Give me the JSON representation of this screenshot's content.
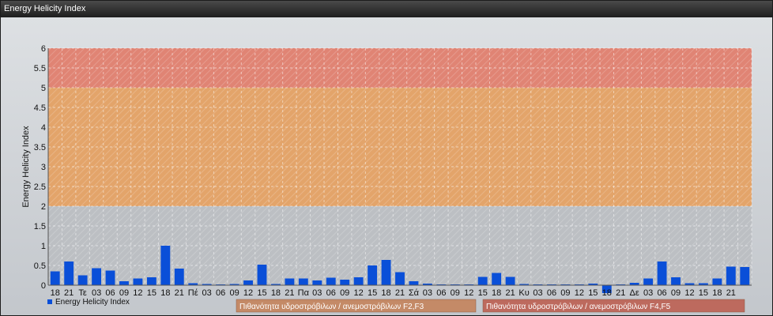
{
  "window": {
    "title": "Energy Helicity Index"
  },
  "chart_data": {
    "type": "bar",
    "ylabel": "Energy Helicity Index",
    "ylim": [
      0,
      6
    ],
    "yticks": [
      "0",
      "0.5",
      "1",
      "1.5",
      "2",
      "2.5",
      "3",
      "3.5",
      "4",
      "4.5",
      "5",
      "5.5",
      "6"
    ],
    "grid": true,
    "categories": [
      "18",
      "21",
      "Τε",
      "03",
      "06",
      "09",
      "12",
      "15",
      "18",
      "21",
      "Πέ",
      "03",
      "06",
      "09",
      "12",
      "15",
      "18",
      "21",
      "Πα",
      "03",
      "06",
      "09",
      "12",
      "15",
      "18",
      "21",
      "Σά",
      "03",
      "06",
      "09",
      "12",
      "15",
      "18",
      "21",
      "Κυ",
      "03",
      "06",
      "09",
      "12",
      "15",
      "18",
      "21",
      "Δε",
      "03",
      "06",
      "09",
      "12",
      "15",
      "18",
      "21"
    ],
    "series": [
      {
        "name": "Energy Helicity Index",
        "color": "#0a4fd8",
        "values": [
          0.35,
          0.6,
          0.25,
          0.43,
          0.37,
          0.1,
          0.17,
          0.2,
          1.0,
          0.42,
          0.05,
          0.03,
          0.02,
          0.03,
          0.12,
          0.52,
          0.03,
          0.17,
          0.17,
          0.12,
          0.19,
          0.14,
          0.2,
          0.5,
          0.64,
          0.33,
          0.1,
          0.04,
          0.02,
          0.02,
          0.02,
          0.21,
          0.31,
          0.21,
          0.03,
          0.02,
          0.02,
          0.02,
          0.02,
          0.04,
          -0.2,
          0.02,
          0.06,
          0.17,
          0.6,
          0.2,
          0.05,
          0.05,
          0.17,
          0.47,
          0.46
        ]
      }
    ],
    "bands": [
      {
        "from": 2,
        "to": 5,
        "color": "#e3a46a"
      },
      {
        "from": 5,
        "to": 6,
        "color": "#e08474"
      }
    ],
    "legend": [
      {
        "label": "Πιθανότητα υδροστρόβιλων / ανεμοστρόβιλων F2,F3",
        "color": "#c48a67"
      },
      {
        "label": "Πιθανότητα υδροστρόβιλων / ανεμοστρόβιλων F4,F5",
        "color": "#bd6a5e"
      }
    ],
    "legend_position": "bottom"
  }
}
